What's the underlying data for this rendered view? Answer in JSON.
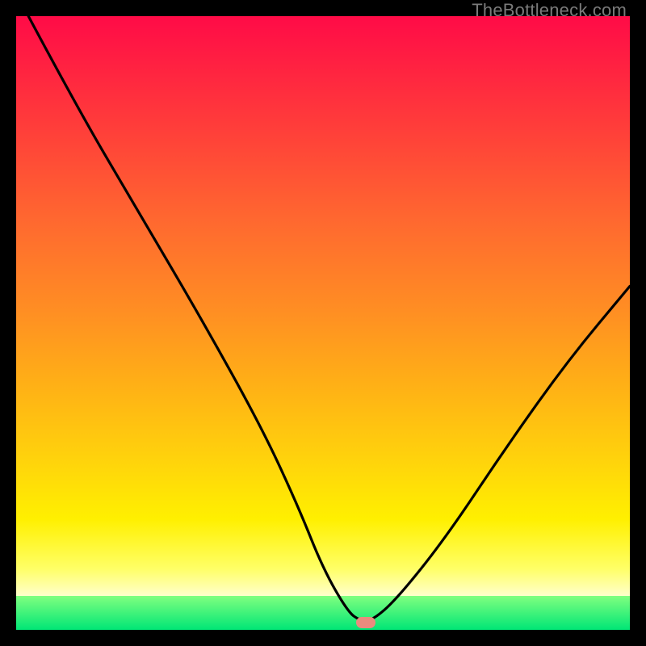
{
  "watermark": "TheBottleneck.com",
  "chart_data": {
    "type": "line",
    "title": "",
    "xlabel": "",
    "ylabel": "",
    "xlim": [
      0,
      100
    ],
    "ylim": [
      0,
      100
    ],
    "grid": false,
    "legend": false,
    "series": [
      {
        "name": "bottleneck-curve",
        "x": [
          2,
          10,
          20,
          30,
          40,
          46,
          50,
          54,
          56,
          58,
          62,
          70,
          80,
          90,
          100
        ],
        "y": [
          100,
          85,
          68,
          51,
          33,
          20,
          10,
          3,
          1.5,
          1.5,
          5,
          15,
          30,
          44,
          56
        ]
      }
    ],
    "marker": {
      "x": 57,
      "y": 1.2,
      "color": "#e98b7e"
    }
  }
}
